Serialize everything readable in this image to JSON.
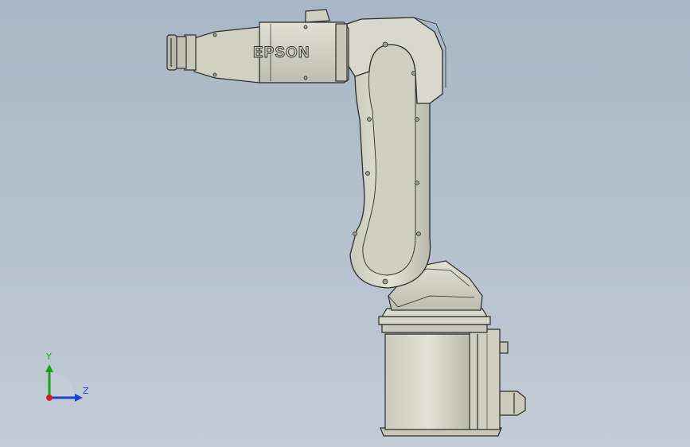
{
  "model": {
    "brand_text": "EPSON",
    "part_fill": "#d4d4c6",
    "part_shade": "#bebfb1",
    "edge_color": "#2b2b2b",
    "screw_color": "#9aa090"
  },
  "triad": {
    "y_label": "Y",
    "z_label": "Z",
    "y_color": "#1aa31a",
    "z_color": "#1c3fd6",
    "x_color": "#d42020"
  },
  "viewport": {
    "bg_top": "#a9b6c5",
    "bg_bottom": "#c3ccd6"
  }
}
